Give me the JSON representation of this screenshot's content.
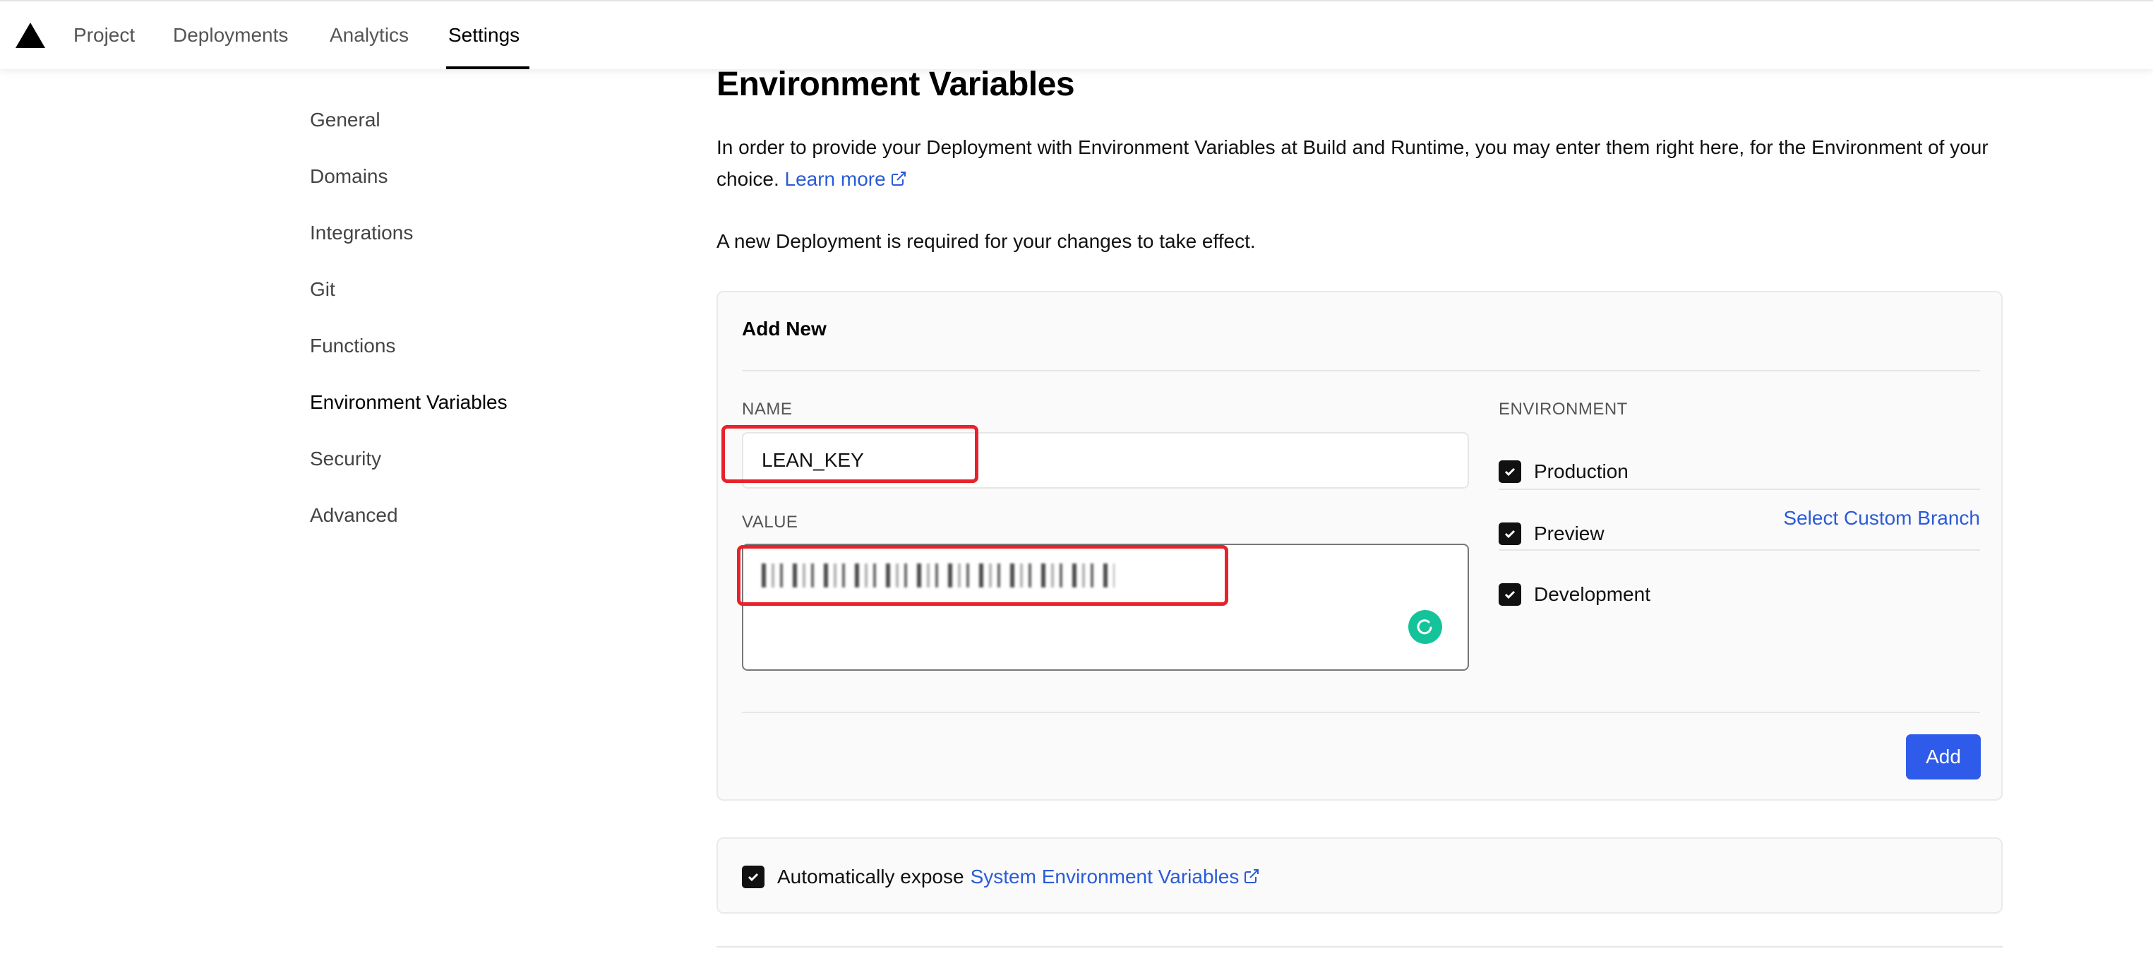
{
  "nav": {
    "tabs": [
      {
        "label": "Project"
      },
      {
        "label": "Deployments"
      },
      {
        "label": "Analytics"
      },
      {
        "label": "Settings"
      }
    ],
    "active_tab": "Settings"
  },
  "sidebar": {
    "items": [
      {
        "label": "General"
      },
      {
        "label": "Domains"
      },
      {
        "label": "Integrations"
      },
      {
        "label": "Git"
      },
      {
        "label": "Functions"
      },
      {
        "label": "Environment Variables"
      },
      {
        "label": "Security"
      },
      {
        "label": "Advanced"
      }
    ],
    "active_item": "Environment Variables"
  },
  "main": {
    "title": "Environment Variables",
    "intro_text": "In order to provide your Deployment with Environment Variables at Build and Runtime, you may enter them right here, for the Environment of your choice.",
    "learn_more": "Learn more",
    "notice": "A new Deployment is required for your changes to take effect."
  },
  "add_new": {
    "title": "Add New",
    "name_label": "NAME",
    "name_value": "LEAN_KEY",
    "value_label": "VALUE",
    "environment_label": "ENVIRONMENT",
    "environments": [
      {
        "label": "Production",
        "checked": true
      },
      {
        "label": "Preview",
        "checked": true
      },
      {
        "label": "Development",
        "checked": true
      }
    ],
    "select_custom_branch": "Select Custom Branch",
    "add_button": "Add"
  },
  "expose": {
    "text": "Automatically expose",
    "link": "System Environment Variables",
    "checked": true
  },
  "colors": {
    "link": "#2a5bd7",
    "add_button": "#2f5bea",
    "annotation": "#e8212a",
    "grammarly": "#15c39a"
  }
}
